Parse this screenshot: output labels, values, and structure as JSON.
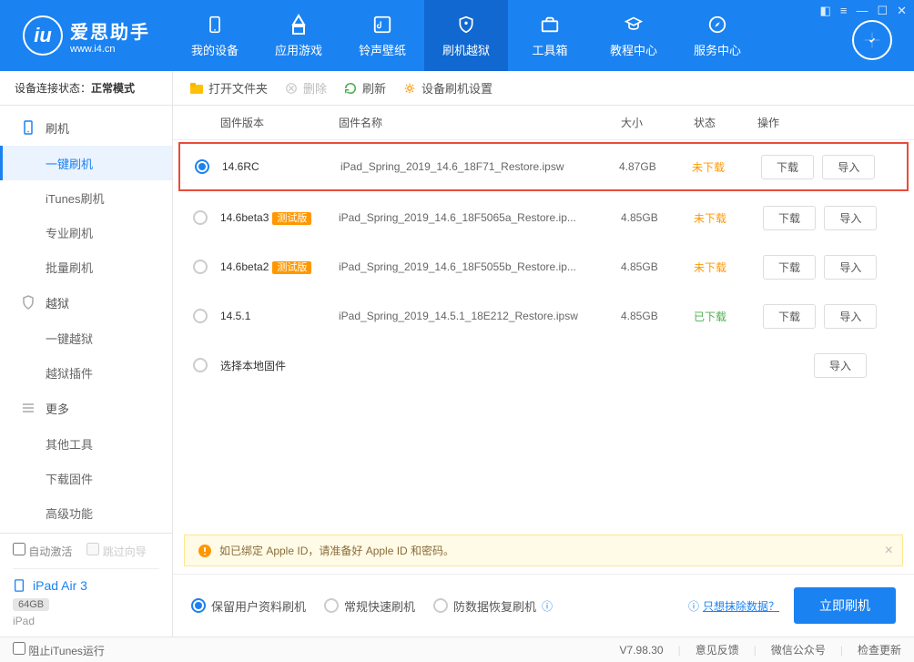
{
  "logo": {
    "title": "爱思助手",
    "subtitle": "www.i4.cn"
  },
  "nav": [
    {
      "label": "我的设备"
    },
    {
      "label": "应用游戏"
    },
    {
      "label": "铃声壁纸"
    },
    {
      "label": "刷机越狱"
    },
    {
      "label": "工具箱"
    },
    {
      "label": "教程中心"
    },
    {
      "label": "服务中心"
    }
  ],
  "device_status": {
    "label": "设备连接状态：",
    "value": "正常模式"
  },
  "toolbar": {
    "open": "打开文件夹",
    "delete": "删除",
    "refresh": "刷新",
    "settings": "设备刷机设置"
  },
  "sidebar": {
    "flash": "刷机",
    "one_click_flash": "一键刷机",
    "itunes_flash": "iTunes刷机",
    "pro_flash": "专业刷机",
    "batch_flash": "批量刷机",
    "jailbreak": "越狱",
    "one_click_jb": "一键越狱",
    "jb_plugins": "越狱插件",
    "more": "更多",
    "other_tools": "其他工具",
    "download_fw": "下载固件",
    "advanced": "高级功能"
  },
  "sidebar_bottom": {
    "auto_activate": "自动激活",
    "skip_guide": "跳过向导",
    "device_name": "iPad Air 3",
    "storage": "64GB",
    "device_type": "iPad"
  },
  "table": {
    "headers": {
      "version": "固件版本",
      "name": "固件名称",
      "size": "大小",
      "status": "状态",
      "actions": "操作"
    },
    "rows": [
      {
        "version": "14.6RC",
        "beta": false,
        "name": "iPad_Spring_2019_14.6_18F71_Restore.ipsw",
        "size": "4.87GB",
        "status": "未下载",
        "status_color": "orange",
        "checked": true,
        "highlighted": true
      },
      {
        "version": "14.6beta3",
        "beta": true,
        "name": "iPad_Spring_2019_14.6_18F5065a_Restore.ip...",
        "size": "4.85GB",
        "status": "未下载",
        "status_color": "orange",
        "checked": false
      },
      {
        "version": "14.6beta2",
        "beta": true,
        "name": "iPad_Spring_2019_14.6_18F5055b_Restore.ip...",
        "size": "4.85GB",
        "status": "未下载",
        "status_color": "orange",
        "checked": false
      },
      {
        "version": "14.5.1",
        "beta": false,
        "name": "iPad_Spring_2019_14.5.1_18E212_Restore.ipsw",
        "size": "4.85GB",
        "status": "已下载",
        "status_color": "green",
        "checked": false
      }
    ],
    "local_fw": "选择本地固件",
    "btn_download": "下载",
    "btn_import": "导入",
    "beta_label": "测试版"
  },
  "warning": "如已绑定 Apple ID，请准备好 Apple ID 和密码。",
  "flash_options": {
    "keep_data": "保留用户资料刷机",
    "normal": "常规快速刷机",
    "recovery": "防数据恢复刷机",
    "erase_link": "只想抹除数据？",
    "flash_btn": "立即刷机"
  },
  "footer": {
    "stop_itunes": "阻止iTunes运行",
    "version": "V7.98.30",
    "feedback": "意见反馈",
    "wechat": "微信公众号",
    "check_update": "检查更新"
  }
}
